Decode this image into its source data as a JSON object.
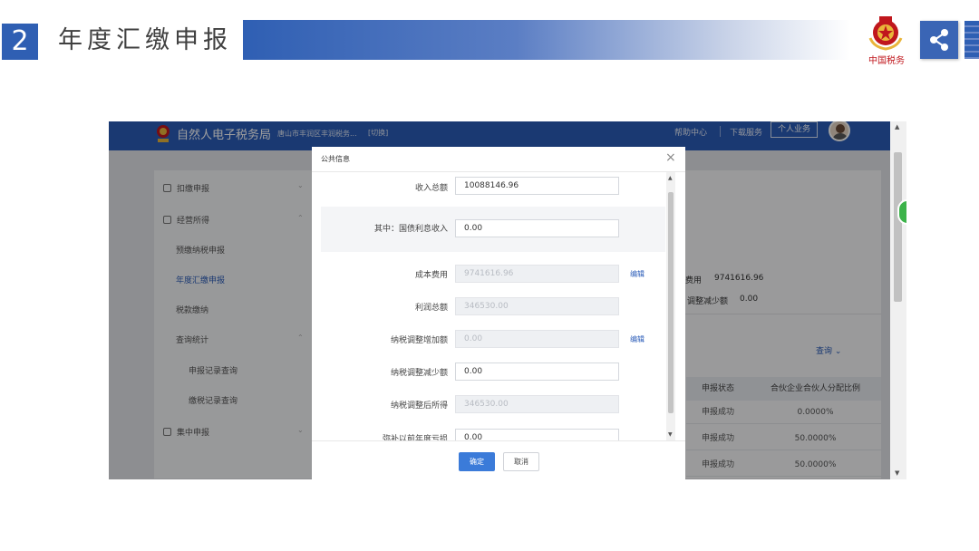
{
  "slide": {
    "number": "2",
    "title": "年度汇缴申报",
    "emblem_text": "中国税务",
    "colors": {
      "accent": "#2f5fb3",
      "emblem_red": "#c0171d"
    }
  },
  "app": {
    "brand": "自然人电子税务局",
    "region": "唐山市丰润区丰润税务...",
    "switch": "[切换]",
    "nav": {
      "help": "帮助中心",
      "download": "下载服务",
      "personal": "个人业务"
    },
    "color_primary": "#2b5cb8"
  },
  "sidebar": {
    "items": [
      {
        "label": "扣缴申报",
        "icon": "document-icon"
      },
      {
        "label": "经营所得",
        "icon": "briefcase-icon"
      },
      {
        "label": "预缴纳税申报"
      },
      {
        "label": "年度汇缴申报",
        "active": true
      },
      {
        "label": "税款缴纳"
      },
      {
        "label": "查询统计"
      },
      {
        "label": "申报记录查询"
      },
      {
        "label": "缴税记录查询"
      },
      {
        "label": "集中申报",
        "icon": "document-icon"
      }
    ]
  },
  "background": {
    "cost_label": "费用",
    "cost_value": "9741616.96",
    "reduce_label": "调整减少额",
    "reduce_value": "0.00",
    "query": "查询",
    "table": {
      "headers": [
        "申报状态",
        "合伙企业合伙人分配比例"
      ],
      "rows": [
        [
          "申报成功",
          "0.0000%"
        ],
        [
          "申报成功",
          "50.0000%"
        ],
        [
          "申报成功",
          "50.0000%"
        ]
      ]
    }
  },
  "modal": {
    "title": "公共信息",
    "close": "×",
    "fields": [
      {
        "label": "收入总额",
        "value": "10088146.96",
        "disabled": false
      },
      {
        "label": "其中：国债利息收入",
        "value": "0.00",
        "disabled": false
      },
      {
        "label": "成本费用",
        "value": "9741616.96",
        "disabled": true,
        "edit": "编辑"
      },
      {
        "label": "利润总额",
        "value": "346530.00",
        "disabled": true
      },
      {
        "label": "纳税调整增加额",
        "value": "0.00",
        "disabled": true,
        "edit": "编辑"
      },
      {
        "label": "纳税调整减少额",
        "value": "0.00",
        "disabled": false
      },
      {
        "label": "纳税调整后所得",
        "value": "346530.00",
        "disabled": true
      },
      {
        "label": "弥补以前年度亏损",
        "value": "0.00",
        "disabled": false
      }
    ],
    "ok": "确定",
    "cancel": "取消"
  }
}
